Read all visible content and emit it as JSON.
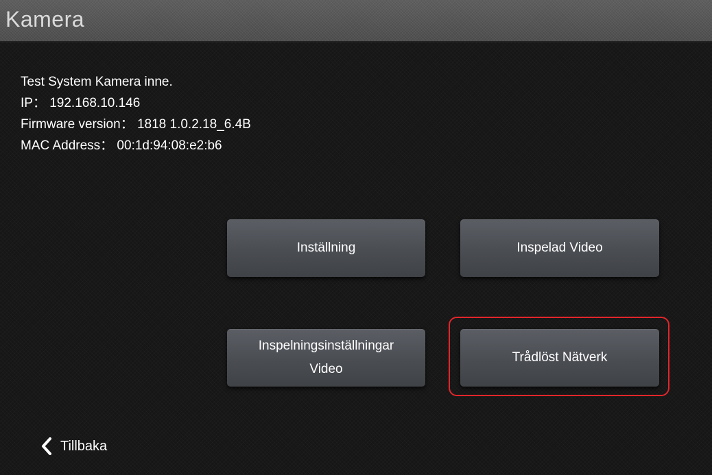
{
  "header": {
    "title": "Kamera"
  },
  "info": {
    "name": "Test System Kamera inne.",
    "ip": "IP： 192.168.10.146",
    "firmware": "Firmware version： 1818 1.0.2.18_6.4B",
    "mac": "MAC Address： 00:1d:94:08:e2:b6"
  },
  "buttons": {
    "installning": "Inställning",
    "inspelad_video": "Inspelad Video",
    "inspelningsinstallningar_line1": "Inspelningsinställningar",
    "inspelningsinstallningar_line2": "Video",
    "tradlost_natverk": "Trådlöst Nätverk"
  },
  "highlight": {
    "color": "#e2252b"
  },
  "back": {
    "label": "Tillbaka",
    "icon": "chevron-left-icon"
  }
}
